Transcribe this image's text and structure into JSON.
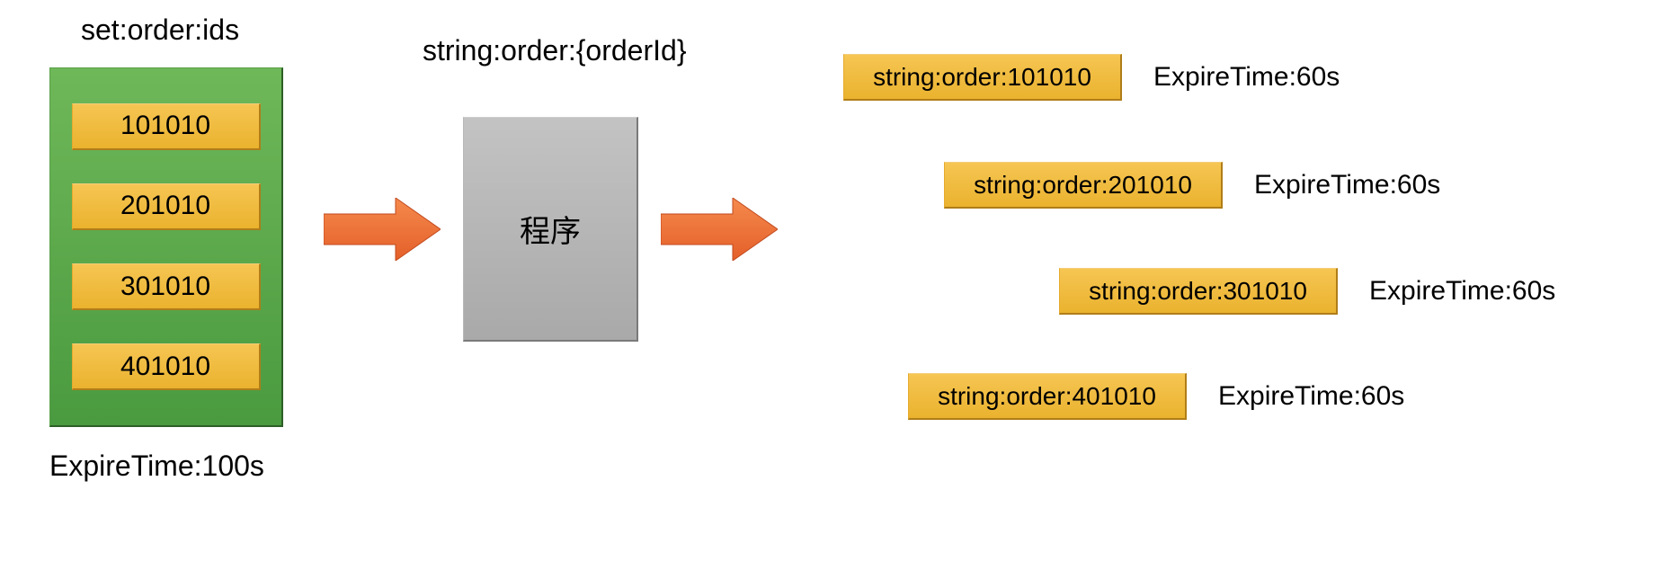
{
  "set": {
    "title": "set:order:ids",
    "items": [
      "101010",
      "201010",
      "301010",
      "401010"
    ],
    "expire_label": "ExpireTime:100s"
  },
  "process": {
    "title": "string:order:{orderId}",
    "box_label": "程序"
  },
  "outputs": [
    {
      "label": "string:order:101010",
      "expire": "ExpireTime:60s"
    },
    {
      "label": "string:order:201010",
      "expire": "ExpireTime:60s"
    },
    {
      "label": "string:order:301010",
      "expire": "ExpireTime:60s"
    },
    {
      "label": "string:order:401010",
      "expire": "ExpireTime:60s"
    }
  ],
  "colors": {
    "green_box_top": "#6fb859",
    "green_box_bottom": "#4a9a3f",
    "yellow_top": "#f6c653",
    "yellow_bottom": "#eab22e",
    "gray_top": "#c3c3c3",
    "gray_bottom": "#a9a9a9",
    "arrow_top": "#f58a4d",
    "arrow_bottom": "#e45f29"
  }
}
